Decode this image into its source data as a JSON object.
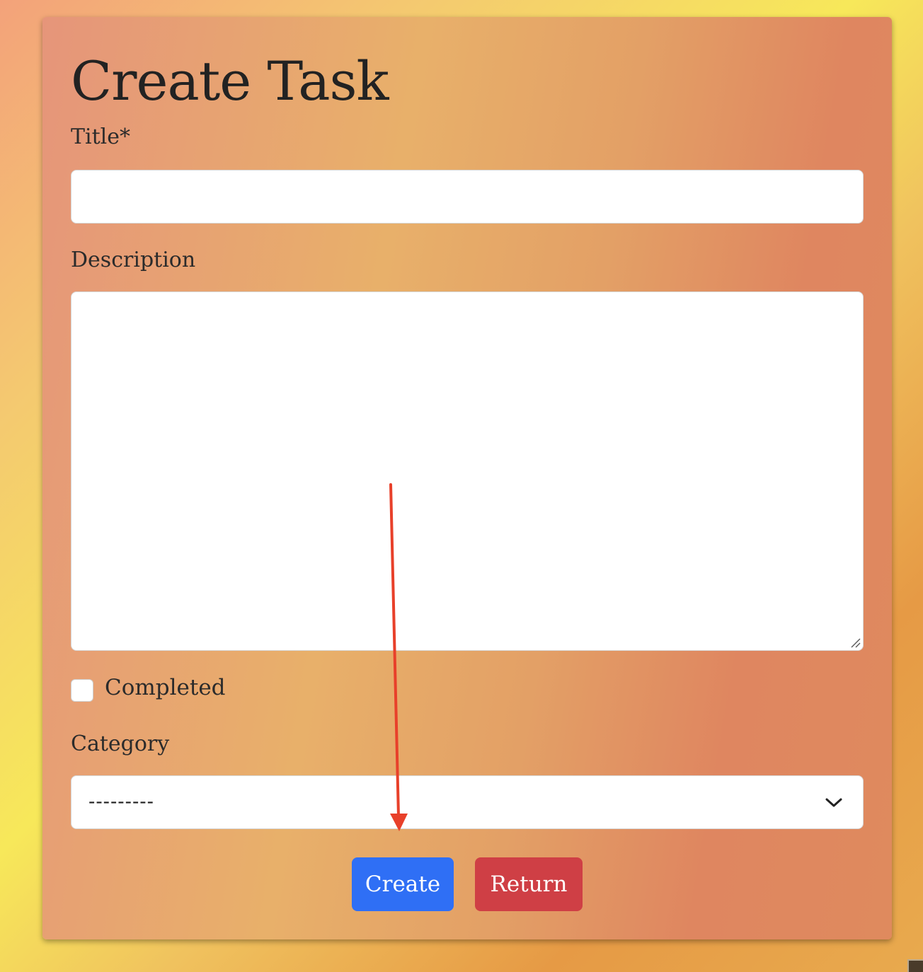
{
  "form": {
    "heading": "Create Task",
    "title_label": "Title*",
    "title_value": "",
    "description_label": "Description",
    "description_value": "",
    "completed_label": "Completed",
    "completed_checked": false,
    "category_label": "Category",
    "category_selected": "---------"
  },
  "actions": {
    "create_label": "Create",
    "return_label": "Return"
  },
  "colors": {
    "create_button": "#2f6ff5",
    "return_button": "#cf3f45",
    "annotation_arrow": "#e8402a"
  },
  "icons": {
    "select_chevron": "chevron-down-icon",
    "textarea_resize": "resize-grip-icon",
    "annotation": "arrow-down-annotation"
  }
}
